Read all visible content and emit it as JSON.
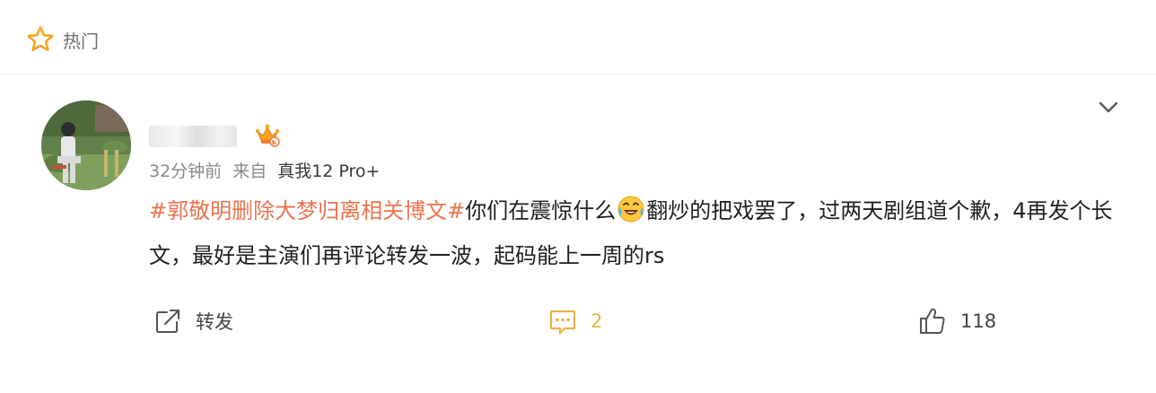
{
  "header": {
    "section_label": "热门",
    "star_icon": "star-outline-icon",
    "accent": "#f5a623"
  },
  "post": {
    "avatar_icon": "avatar-image",
    "username_obscured": true,
    "vip_icon": "vip-crown-badge-icon",
    "menu_icon": "chevron-down-icon",
    "meta": {
      "time": "32分钟前",
      "from_label": "来自",
      "device": "真我12 Pro+"
    },
    "content": {
      "hashtag": "#郭敬明删除大梦归离相关博文#",
      "text_before_emoji": "你们在震惊什么",
      "emoji": "laugh-cry-emoji",
      "text_after_emoji": "翻炒的把戏罢了，过两天剧组道个歉，4再发个长文，最好是主演们再评论转发一波，起码能上一周的rs"
    },
    "colors": {
      "hashtag": "#eb7350",
      "comment_accent": "#e8b344"
    }
  },
  "actions": {
    "repost": {
      "label": "转发",
      "icon": "share-icon"
    },
    "comment": {
      "count": "2",
      "icon": "comment-icon"
    },
    "like": {
      "count": "118",
      "icon": "thumbs-up-icon"
    }
  }
}
